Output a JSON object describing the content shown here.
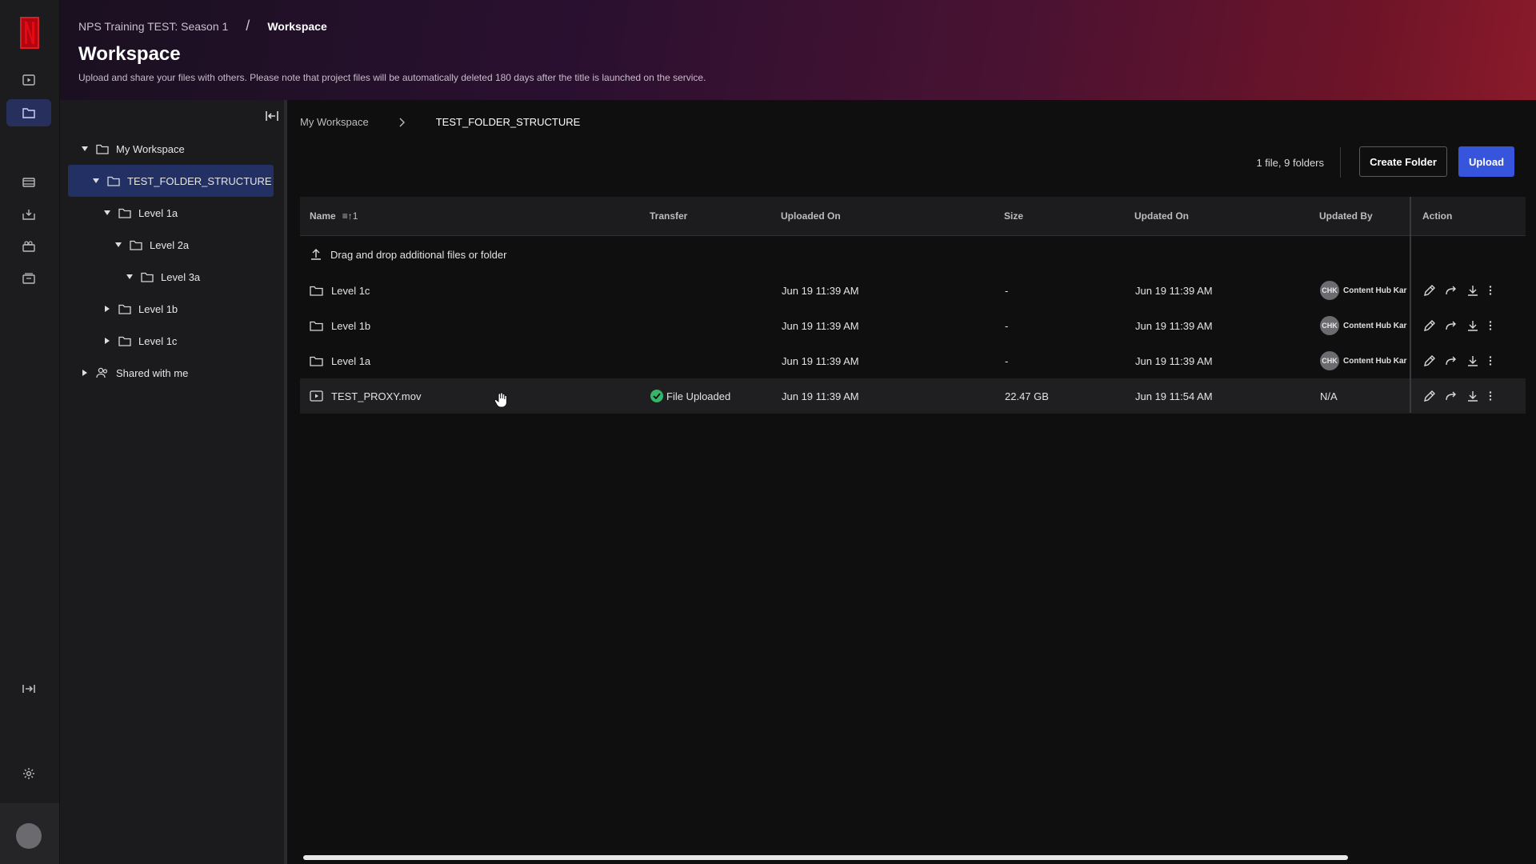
{
  "header": {
    "breadcrumb_project": "NPS Training TEST: Season 1",
    "breadcrumb_sep": "/",
    "breadcrumb_current": "Workspace",
    "title": "Workspace",
    "subtitle": "Upload and share your files with others. Please note that project files will be automatically deleted 180 days after the title is launched on the service."
  },
  "rail": {
    "icons": [
      "netflix-logo",
      "player-icon",
      "folder-icon",
      "film-icon",
      "inbox-icon",
      "camera-icon",
      "archive-icon",
      "expand-icon",
      "gear-icon"
    ],
    "active": "folder-icon"
  },
  "tree": {
    "items": [
      {
        "label": "My Workspace",
        "level": 0,
        "expanded": true
      },
      {
        "label": "TEST_FOLDER_STRUCTURE",
        "level": 1,
        "expanded": true,
        "selected": true
      },
      {
        "label": "Level 1a",
        "level": 2,
        "expanded": true
      },
      {
        "label": "Level 2a",
        "level": 3,
        "expanded": true
      },
      {
        "label": "Level 3a",
        "level": 4,
        "expanded": true
      },
      {
        "label": "Level 1b",
        "level": 2,
        "expanded": false
      },
      {
        "label": "Level 1c",
        "level": 2,
        "expanded": false
      },
      {
        "label": "Shared with me",
        "level": 0,
        "expanded": false
      }
    ]
  },
  "main": {
    "path_root": "My Workspace",
    "path_current": "TEST_FOLDER_STRUCTURE",
    "count": "1 file, 9 folders",
    "create_folder_label": "Create Folder",
    "upload_label": "Upload",
    "columns": {
      "name": "Name",
      "sort": "≡↑1",
      "transfer": "Transfer",
      "uploaded_on": "Uploaded On",
      "size": "Size",
      "updated_on": "Updated On",
      "updated_by": "Updated By",
      "action": "Action"
    },
    "dropzone": "Drag and drop additional files or folder",
    "rows": [
      {
        "name": "Level 1c",
        "type": "folder",
        "transfer": "",
        "uploaded_on": "Jun 19 11:39 AM",
        "size": "-",
        "updated_on": "Jun 19 11:39 AM",
        "by_initials": "CHK",
        "by_name": "Content Hub Kar"
      },
      {
        "name": "Level 1b",
        "type": "folder",
        "transfer": "",
        "uploaded_on": "Jun 19 11:39 AM",
        "size": "-",
        "updated_on": "Jun 19 11:39 AM",
        "by_initials": "CHK",
        "by_name": "Content Hub Kar"
      },
      {
        "name": "Level 1a",
        "type": "folder",
        "transfer": "",
        "uploaded_on": "Jun 19 11:39 AM",
        "size": "-",
        "updated_on": "Jun 19 11:39 AM",
        "by_initials": "CHK",
        "by_name": "Content Hub Kar"
      },
      {
        "name": "TEST_PROXY.mov",
        "type": "video",
        "transfer": "File Uploaded",
        "uploaded_on": "Jun 19 11:39 AM",
        "size": "22.47 GB",
        "updated_on": "Jun 19 11:54 AM",
        "by_initials": "",
        "by_name": "N/A"
      }
    ]
  }
}
